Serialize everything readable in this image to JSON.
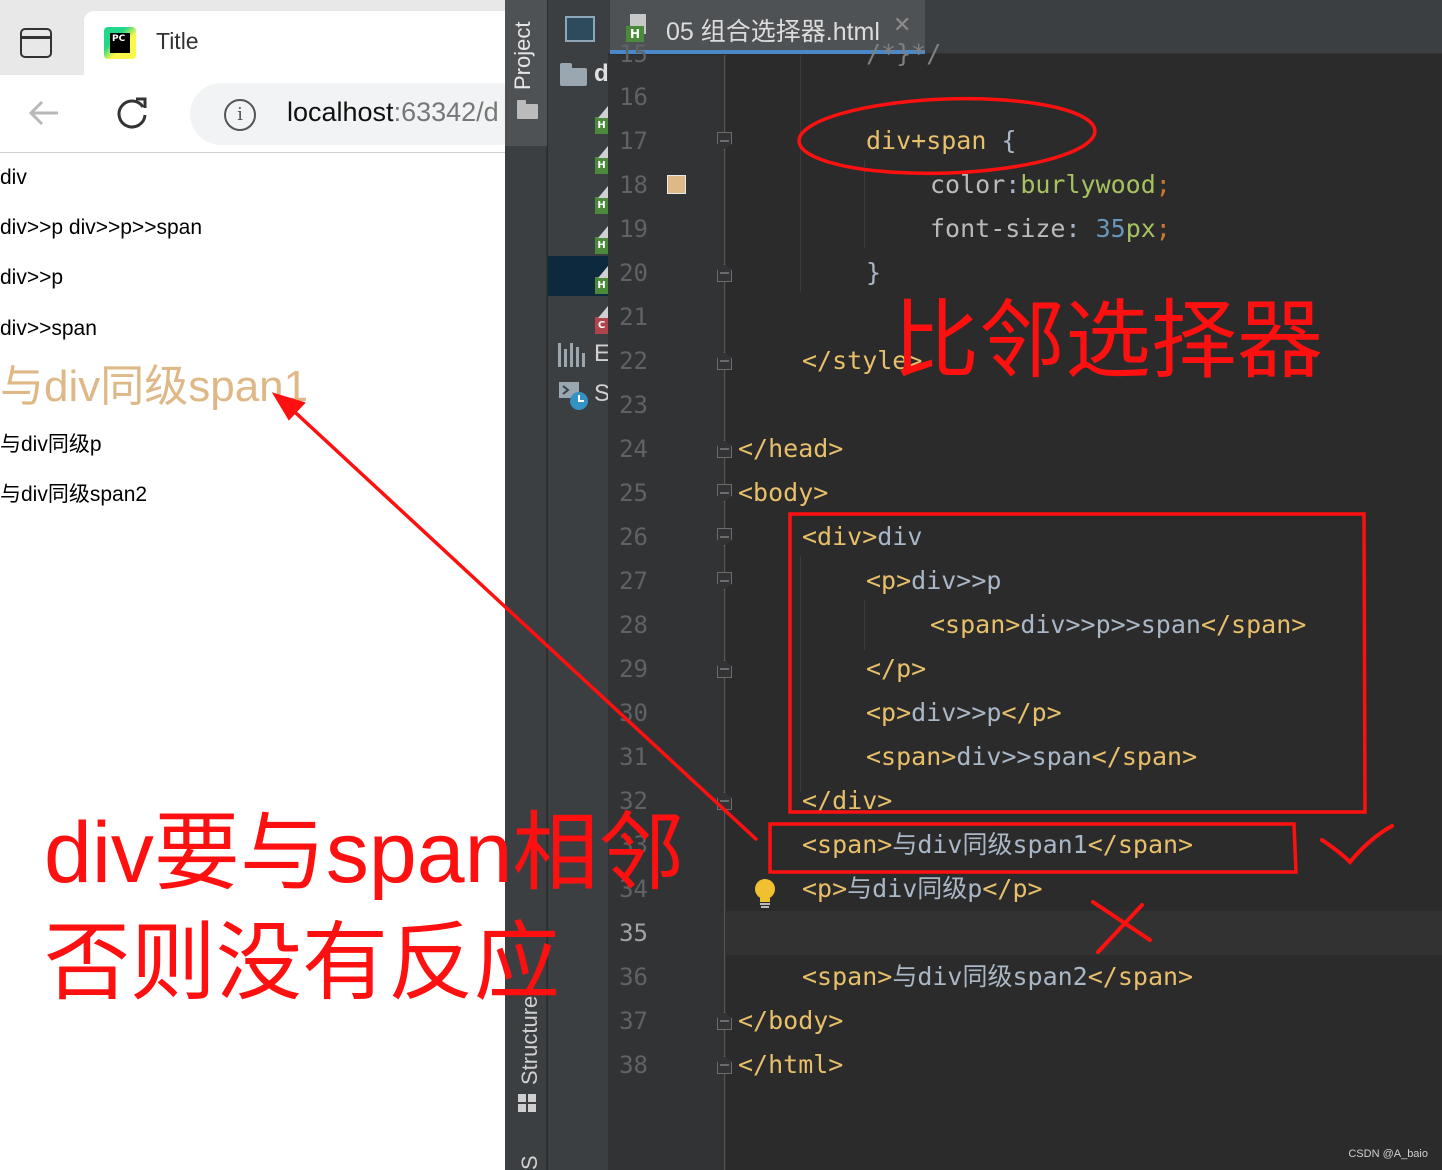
{
  "browser": {
    "tab_title": "Title",
    "pc_logo_text": "PC",
    "address_host": "localhost",
    "address_rest": ":63342/d",
    "output": {
      "line1": "div",
      "line2": "div>>p div>>p>>span",
      "line3": "div>>p",
      "line4": "div>>span",
      "line5_big": "与div同级span1",
      "line6": "与div同级p",
      "line7": "与div同级span2"
    },
    "styled_color": "#deb887"
  },
  "ide": {
    "project_tool_label": "Project",
    "structure_tool_label": "Structure",
    "bottom_tool_label": "S",
    "tree": {
      "folder_letter": "d",
      "ext_libs_letter": "E",
      "scratches_letter": "S",
      "html_badge": "H",
      "css_badge": "C"
    },
    "tab": {
      "label": "05 组合选择器.html",
      "close": "✕"
    },
    "line_numbers": [
      "15",
      "16",
      "17",
      "18",
      "19",
      "20",
      "21",
      "22",
      "23",
      "24",
      "25",
      "26",
      "27",
      "28",
      "29",
      "30",
      "31",
      "32",
      "33",
      "34",
      "35",
      "36",
      "37",
      "38"
    ],
    "code": {
      "l15": "/*}*/",
      "l17_sel": "div+span",
      "l17_brace": " {",
      "l18_prop": "color",
      "l18_colon": ":",
      "l18_val": "burlywood",
      "l18_semi": ";",
      "l19_prop": "font-size",
      "l19_colon": ": ",
      "l19_num": "35",
      "l19_unit": "px",
      "l19_semi": ";",
      "l20": "}",
      "l22": "</style>",
      "l24": "</head>",
      "l25": "<body>",
      "l26_tag": "<div>",
      "l26_txt": "div",
      "l27_tag": "<p>",
      "l27_txt": "div>>p",
      "l28_open": "<span>",
      "l28_txt": "div>>p>>span",
      "l28_close": "</span>",
      "l29": "</p>",
      "l30_open": "<p>",
      "l30_txt": "div>>p",
      "l30_close": "</p>",
      "l31_open": "<span>",
      "l31_txt": "div>>span",
      "l31_close": "</span>",
      "l32": "</div>",
      "l33_open": "<span>",
      "l33_txt": "与div同级span1",
      "l33_close": "</span>",
      "l34_open": "<p>",
      "l34_txt": "与div同级p",
      "l34_close": "</p>",
      "l36_open": "<span>",
      "l36_txt": "与div同级span2",
      "l36_close": "</span>",
      "l37": "</body>",
      "l38": "</html>"
    },
    "swatch_color": "#deb887"
  },
  "annotations": {
    "title": "比邻选择器",
    "note_line1": "div要与span相邻",
    "note_line2": "否则没有反应",
    "color": "#ff1010"
  },
  "watermark": "CSDN @A_baio"
}
